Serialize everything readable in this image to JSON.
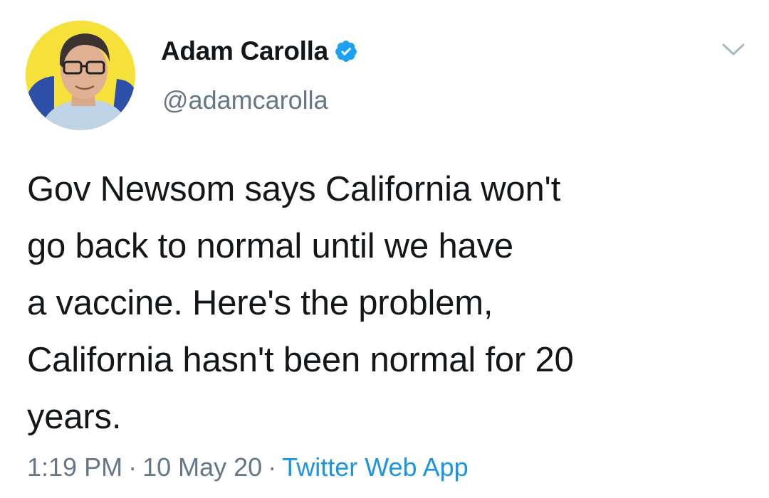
{
  "author": {
    "display_name": "Adam Carolla",
    "handle": "@adamcarolla",
    "verified_icon": "verified-badge-icon",
    "avatar_bg_color": "#f6e03a"
  },
  "tweet": {
    "lines": [
      "Gov Newsom says California won't",
      "go back to normal until we have",
      "a vaccine. Here's the problem,",
      "California hasn't been normal for 20",
      "years."
    ]
  },
  "meta": {
    "time": "1:19 PM",
    "date": "10 May 20",
    "separator": "·",
    "source": "Twitter Web App"
  },
  "colors": {
    "text": "#14171a",
    "secondary": "#657786",
    "link": "#1b95e0",
    "verified": "#1da1f2"
  },
  "menu": {
    "icon": "chevron-down-icon"
  }
}
